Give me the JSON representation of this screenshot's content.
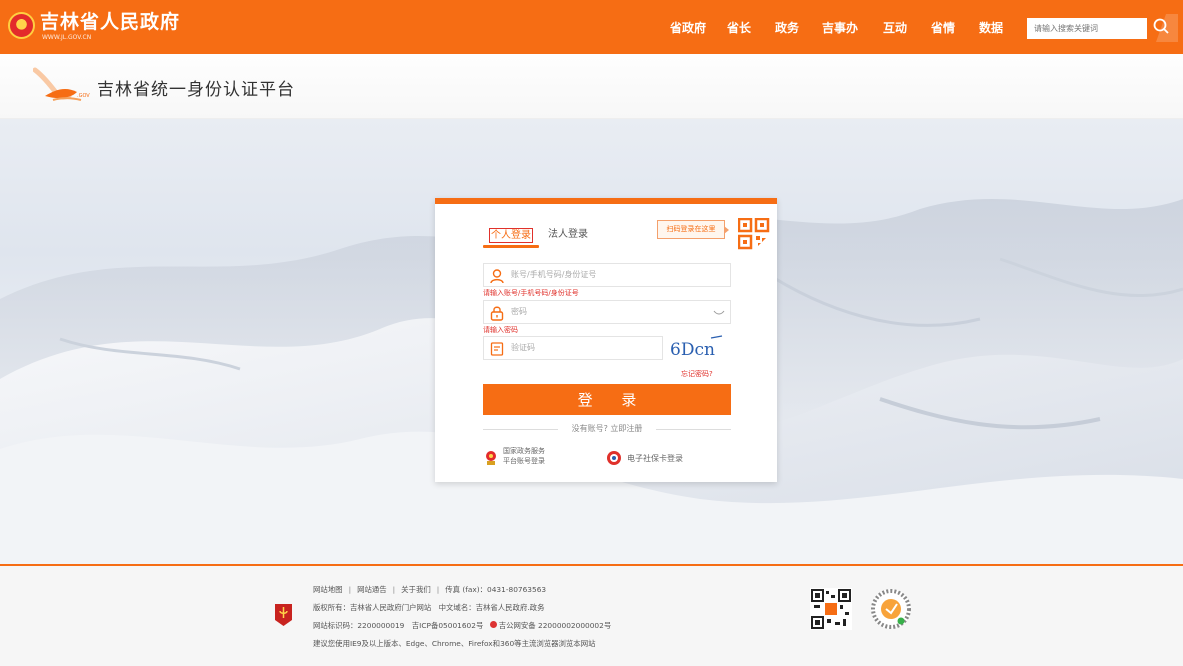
{
  "site": {
    "title": "吉林省人民政府",
    "subtitle": "WWW.JL.GOV.CN"
  },
  "nav": [
    "省政府",
    "省长",
    "政务",
    "吉事办",
    "互动",
    "省情",
    "数据"
  ],
  "search": {
    "placeholder": "请输入搜索关键词"
  },
  "platform": {
    "title": "吉林省统一身份认证平台"
  },
  "login": {
    "tabs": {
      "personal": "个人登录",
      "legal": "法人登录"
    },
    "qr_hint": "扫码登录在这里",
    "account_placeholder": "账号/手机号码/身份证号",
    "account_error": "请输入账号/手机号码/身份证号",
    "password_placeholder": "密码",
    "password_error": "请输入密码",
    "captcha_placeholder": "验证码",
    "captcha_text": "6Dcn",
    "forgot": "忘记密码?",
    "submit": "登 录",
    "register": "没有账号? 立即注册",
    "alt_national_line1": "国家政务服务",
    "alt_national_line2": "平台账号登录",
    "alt_card": "电子社保卡登录"
  },
  "footer": {
    "links": [
      "网站地图",
      "网站通告",
      "关于我们"
    ],
    "fax": "传真 (fax)：0431-80763563",
    "copyright": "版权所有：吉林省人民政府门户网站　中文域名：吉林省人民政府.政务",
    "site_id": "网站标识码：2200000019　吉ICP备05001602号",
    "police": "吉公网安备 22000002000002号",
    "browser_tip": "建议您使用IE9及以上版本、Edge、Chrome、Firefox和360等主流浏览器浏览本网站"
  },
  "colors": {
    "accent": "#f66d14",
    "error": "#e0312b"
  }
}
